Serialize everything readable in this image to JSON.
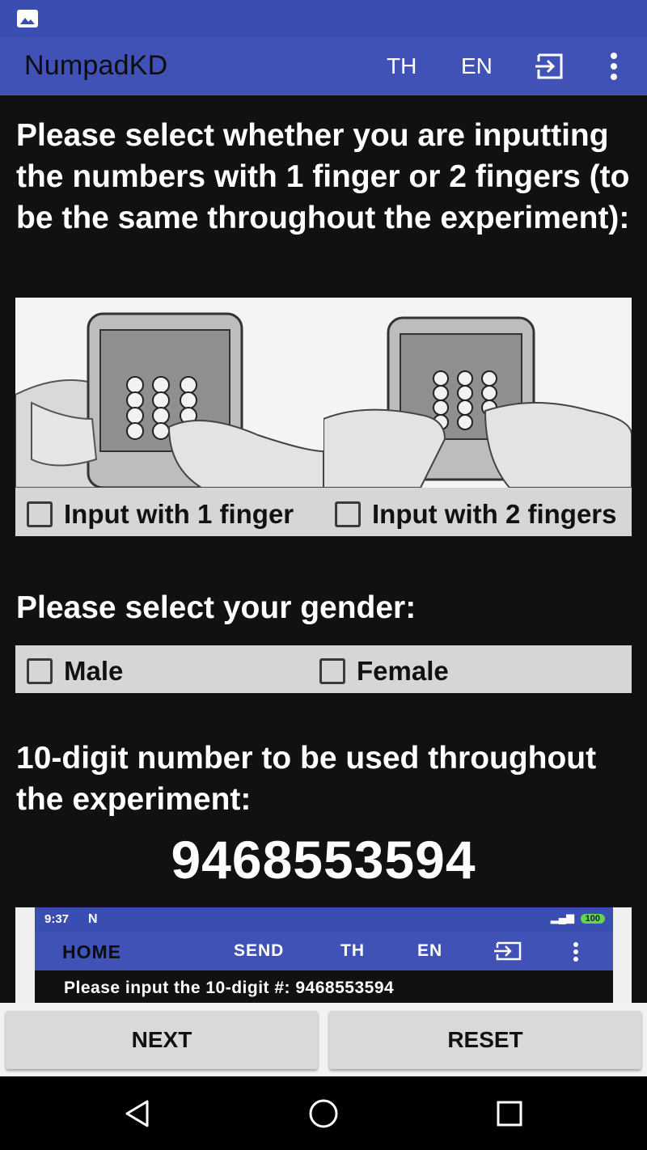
{
  "app": {
    "title": "NumpadKD",
    "actions": {
      "th": "TH",
      "en": "EN"
    }
  },
  "finger_section": {
    "prompt": "Please select whether you are inputting the numbers with 1 finger or 2 fingers (to be the same throughout the experiment):",
    "options": [
      {
        "label": "Input with 1 finger",
        "checked": false
      },
      {
        "label": "Input with 2 fingers",
        "checked": false
      }
    ]
  },
  "gender_section": {
    "prompt": "Please select your gender:",
    "options": [
      {
        "label": "Male",
        "checked": false
      },
      {
        "label": "Female",
        "checked": false
      }
    ]
  },
  "number_section": {
    "prompt": "10-digit number to be used throughout the experiment:",
    "number": "9468553594"
  },
  "preview": {
    "time": "9:37",
    "battery": "100",
    "home": "HOME",
    "send": "SEND",
    "th": "TH",
    "en": "EN",
    "prompt": "Please input the 10-digit #: 9468553594"
  },
  "buttons": {
    "next": "NEXT",
    "reset": "RESET"
  },
  "icons": {
    "status": "image-icon",
    "exit": "exit-to-app-icon",
    "more": "more-vert-icon",
    "nav": [
      "back-icon",
      "home-icon",
      "recents-icon"
    ]
  },
  "colors": {
    "app_bar": "#4052b5",
    "status_bar": "#3a4db0",
    "background": "#111111",
    "panel": "#d6d6d6",
    "button": "#d9d9d9"
  }
}
